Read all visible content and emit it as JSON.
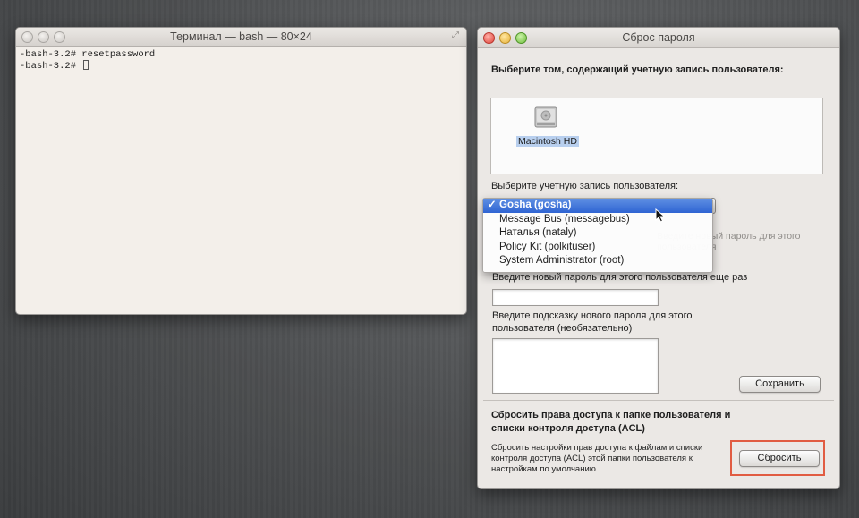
{
  "terminal": {
    "title": "Терминал — bash — 80×24",
    "line1": "-bash-3.2# resetpassword",
    "line2": "-bash-3.2# "
  },
  "reset": {
    "title": "Сброс пароля",
    "select_volume_label": "Выберите том, содержащий учетную запись пользователя:",
    "volume_name": "Macintosh HD",
    "select_user_label": "Выберите учетную запись пользователя:",
    "user_menu": {
      "items": [
        "Gosha (gosha)",
        "Message Bus (messagebus)",
        "Наталья (nataly)",
        "Policy Kit (polkituser)",
        "System Administrator (root)"
      ],
      "selected": "Gosha (gosha)",
      "check": "✓"
    },
    "hidden_new_password_label": "Введите новый пароль для этого пользователя",
    "repeat_password_label": "Введите новый пароль для этого пользователя еще раз",
    "hint_label_line1": "Введите подсказку нового пароля для этого",
    "hint_label_line2": "пользователя (необязательно)",
    "save_button": "Сохранить",
    "acl_title_line1": "Сбросить права доступа к папке пользователя и",
    "acl_title_line2": "списки контроля доступа (ACL)",
    "acl_desc_line1": "Сбросить настройки прав доступа к файлам и списки",
    "acl_desc_line2": "контроля доступа (ACL) этой папки пользователя к",
    "acl_desc_line3": "настройкам по умолчанию.",
    "reset_button": "Сбросить"
  },
  "colors": {
    "selection": "#2f64d3",
    "highlight_box": "#e15c42"
  }
}
